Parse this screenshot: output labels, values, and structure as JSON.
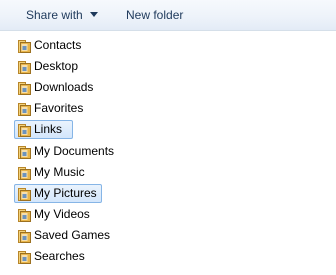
{
  "toolbar": {
    "share_label": "Share with",
    "new_folder_label": "New folder"
  },
  "folders": [
    {
      "label": "Contacts",
      "icon": "contacts-folder-icon"
    },
    {
      "label": "Desktop",
      "icon": "desktop-folder-icon"
    },
    {
      "label": "Downloads",
      "icon": "downloads-folder-icon"
    },
    {
      "label": "Favorites",
      "icon": "favorites-folder-icon"
    },
    {
      "label": "Links",
      "icon": "links-folder-icon",
      "selected": true
    },
    {
      "label": "My Documents",
      "icon": "documents-folder-icon"
    },
    {
      "label": "My Music",
      "icon": "music-folder-icon"
    },
    {
      "label": "My Pictures",
      "icon": "pictures-folder-icon",
      "selected": true
    },
    {
      "label": "My Videos",
      "icon": "videos-folder-icon"
    },
    {
      "label": "Saved Games",
      "icon": "saved-games-folder-icon"
    },
    {
      "label": "Searches",
      "icon": "searches-folder-icon"
    }
  ],
  "colors": {
    "folder": "#e8b54a",
    "selection_bg": "#d3e6fb",
    "selection_border": "#86b5e6",
    "toolbar_text": "#1e395b"
  }
}
